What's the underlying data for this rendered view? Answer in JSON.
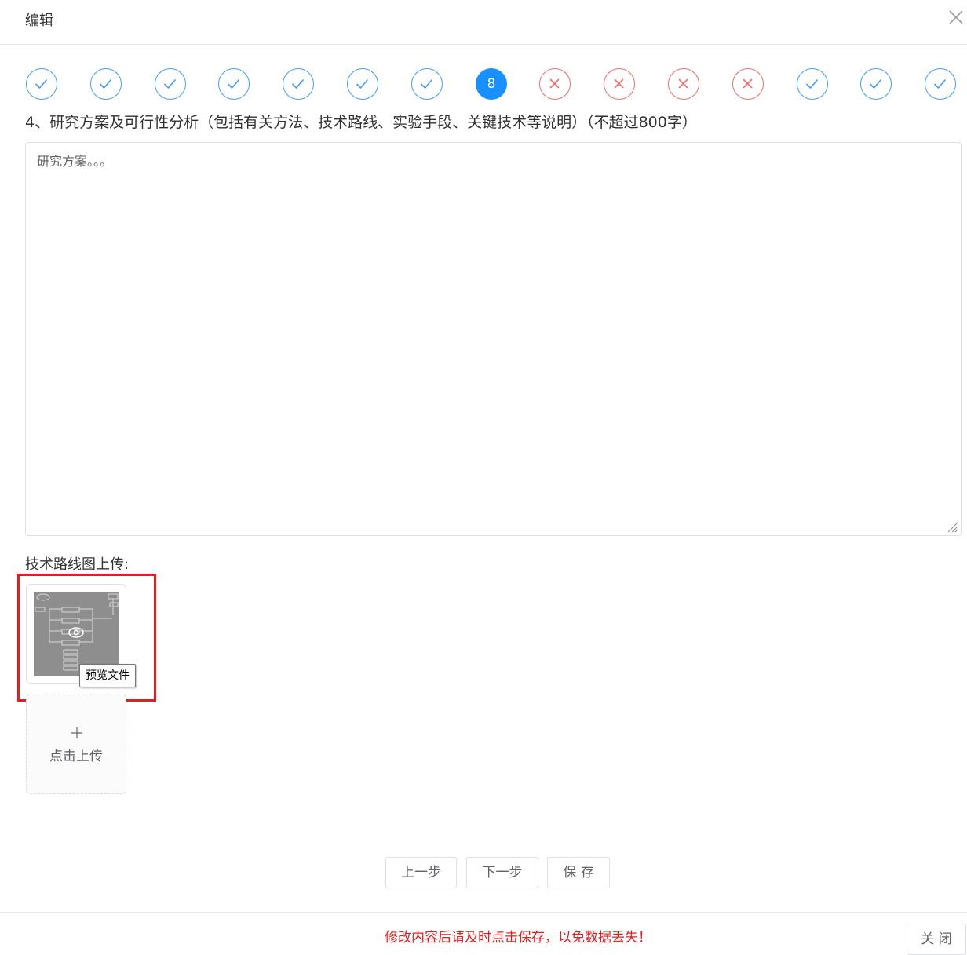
{
  "dialog": {
    "title": "编辑",
    "close_icon": "close-icon"
  },
  "steps": [
    {
      "status": "done"
    },
    {
      "status": "done"
    },
    {
      "status": "done"
    },
    {
      "status": "done"
    },
    {
      "status": "done"
    },
    {
      "status": "done"
    },
    {
      "status": "done"
    },
    {
      "status": "current",
      "label": "8"
    },
    {
      "status": "error"
    },
    {
      "status": "error"
    },
    {
      "status": "error"
    },
    {
      "status": "error"
    },
    {
      "status": "done"
    },
    {
      "status": "done"
    },
    {
      "status": "done"
    }
  ],
  "colors": {
    "primary": "#409eff",
    "current": "#1890ff",
    "error": "#f56c6c",
    "warning_text": "#e02020",
    "highlight_border": "#e02020"
  },
  "question": {
    "text": "4、研究方案及可行性分析（包括有关方法、技术路线、实验手段、关键技术等说明）（不超过800字）"
  },
  "answer": {
    "value": "研究方案。。。"
  },
  "upload": {
    "label": "技术路线图上传:",
    "preview_tooltip": "预览文件",
    "upload_button": "点击上传"
  },
  "actions": {
    "prev": "上一步",
    "next": "下一步",
    "save": "保 存"
  },
  "footer": {
    "warning": "修改内容后请及时点击保存，以免数据丢失！",
    "close": "关 闭"
  }
}
